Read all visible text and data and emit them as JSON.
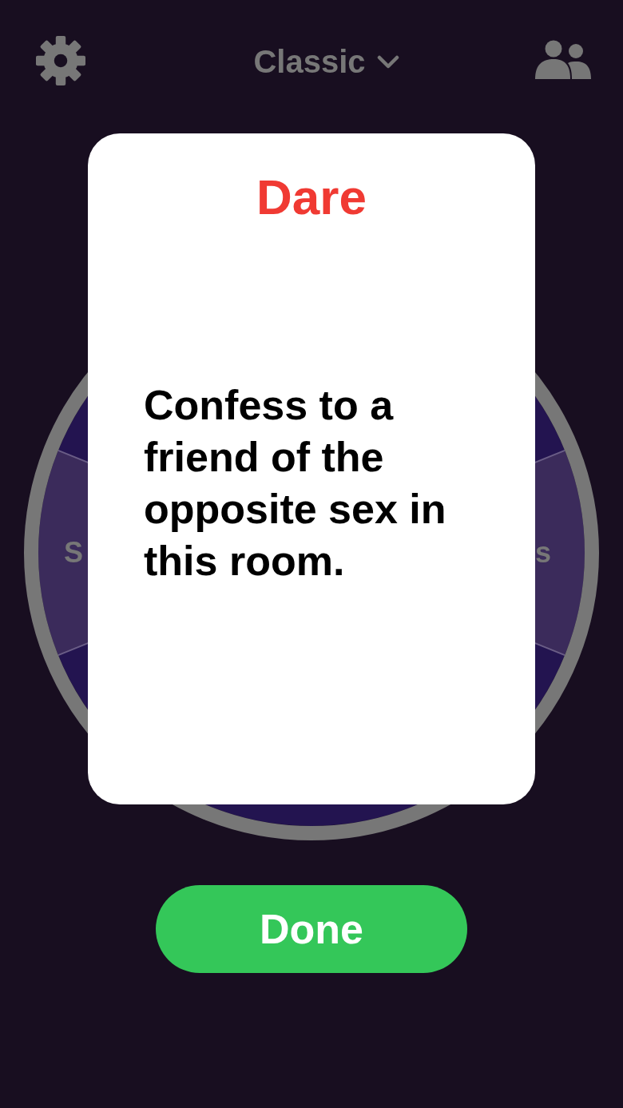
{
  "header": {
    "mode": "Classic"
  },
  "wheel": {
    "labels": [
      "S",
      "s"
    ]
  },
  "card": {
    "title": "Dare",
    "text": "Confess to a friend of the opposite sex in this room."
  },
  "done_button": {
    "label": "Done"
  }
}
